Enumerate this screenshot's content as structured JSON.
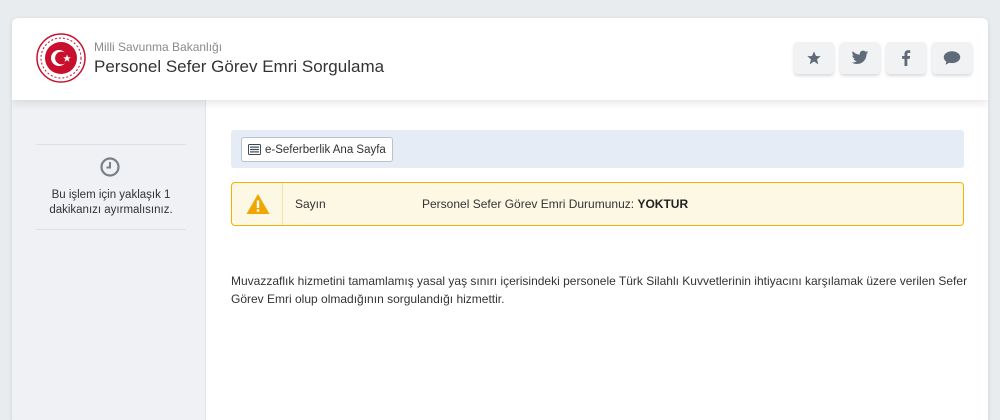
{
  "header": {
    "org_name": "Milli Savunma Bakanlığı",
    "title": "Personel Sefer Görev Emri Sorgulama",
    "logo_icon": "ministry-emblem-icon",
    "social": [
      {
        "name": "favorite",
        "icon": "star-icon"
      },
      {
        "name": "twitter",
        "icon": "twitter-icon"
      },
      {
        "name": "facebook",
        "icon": "facebook-icon"
      },
      {
        "name": "comment",
        "icon": "chat-icon"
      }
    ]
  },
  "sidebar": {
    "icon": "clock-icon",
    "info_text": "Bu işlem için yaklaşık 1 dakikanızı ayırmalısınız."
  },
  "navbar": {
    "home_label": "e-Seferberlik Ana Sayfa",
    "home_icon": "list-icon"
  },
  "alert": {
    "icon": "warning-icon",
    "prefix": "Sayın",
    "message": "Personel Sefer Görev Emri Durumunuz:",
    "status": "YOKTUR"
  },
  "description": "Muvazzaflık hizmetini tamamlamış yasal yaş sınırı içerisindeki personele Türk Silahlı Kuvvetlerinin ihtiyacını karşılamak üzere verilen Sefer Görev Emri olup olmadığının sorgulandığı hizmettir.",
  "colors": {
    "accent_red": "#c8102e",
    "warning": "#f0b400",
    "alert_bg": "#fdf8e4",
    "nav_bg": "#e6ecf5",
    "sidebar_bg": "#eff1f4"
  }
}
